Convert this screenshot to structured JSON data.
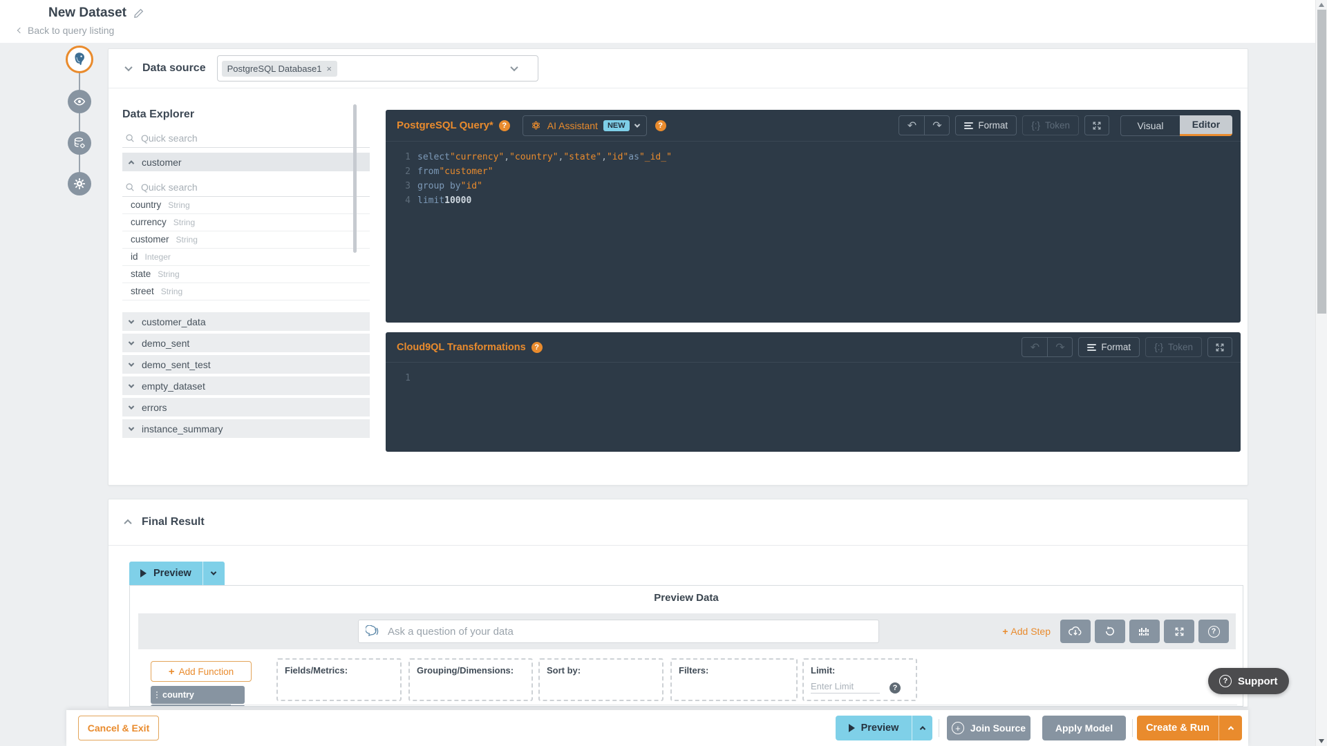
{
  "colors": {
    "accent_orange": "#e98b2d",
    "accent_blue": "#7fd0e8",
    "panel_dark": "#2d3a47",
    "button_gray": "#8794a1"
  },
  "icons": [
    "edit-pencil-icon",
    "back-chevron-icon",
    "postgresql-icon",
    "eye-icon",
    "database-gear-icon",
    "gear-icon",
    "search-icon",
    "chevron-icon",
    "help-icon",
    "openai-icon",
    "undo-icon",
    "redo-icon",
    "format-icon",
    "token-icon",
    "expand-icon",
    "play-icon",
    "ask-voice-icon",
    "download-icon",
    "refresh-icon",
    "chart-icon",
    "plus-icon",
    "drag-handle-icon",
    "question-icon"
  ],
  "header": {
    "title": "New Dataset",
    "back": "Back to query listing"
  },
  "datasource": {
    "label": "Data source",
    "selected_tag": "PostgreSQL Database1",
    "remove": "×"
  },
  "explorer": {
    "title": "Data Explorer",
    "search_placeholder": "Quick search",
    "inner_search_placeholder": "Quick search",
    "expanded_table": "customer",
    "fields": [
      {
        "name": "country",
        "type": "String"
      },
      {
        "name": "currency",
        "type": "String"
      },
      {
        "name": "customer",
        "type": "String"
      },
      {
        "name": "id",
        "type": "Integer"
      },
      {
        "name": "state",
        "type": "String"
      },
      {
        "name": "street",
        "type": "String"
      }
    ],
    "tables": [
      "customer_data",
      "demo_sent",
      "demo_sent_test",
      "empty_dataset",
      "errors",
      "instance_summary"
    ]
  },
  "sql_editor": {
    "title": "PostgreSQL Query*",
    "ai_assistant": "AI Assistant",
    "new_badge": "NEW",
    "undo": "↶",
    "redo": "↷",
    "format": "Format",
    "token": "Token",
    "token_glyph": "{:}",
    "visual": "Visual",
    "editor": "Editor",
    "code_lines": [
      {
        "n": "1",
        "tokens": [
          {
            "c": "kw",
            "t": "select "
          },
          {
            "c": "str",
            "t": "\"currency\""
          },
          {
            "c": "pln",
            "t": ", "
          },
          {
            "c": "str",
            "t": "\"country\""
          },
          {
            "c": "pln",
            "t": ", "
          },
          {
            "c": "str",
            "t": "\"state\""
          },
          {
            "c": "pln",
            "t": ", "
          },
          {
            "c": "str",
            "t": "\"id\""
          },
          {
            "c": "kw",
            "t": " as "
          },
          {
            "c": "str",
            "t": "\"_id_\""
          }
        ]
      },
      {
        "n": "2",
        "tokens": [
          {
            "c": "kw",
            "t": "from "
          },
          {
            "c": "str",
            "t": "\"customer\""
          }
        ]
      },
      {
        "n": "3",
        "tokens": [
          {
            "c": "kw",
            "t": "group by "
          },
          {
            "c": "str",
            "t": "\"id\""
          }
        ]
      },
      {
        "n": "4",
        "tokens": [
          {
            "c": "kw",
            "t": "limit "
          },
          {
            "c": "num",
            "t": "10000"
          }
        ]
      }
    ]
  },
  "transformations": {
    "title": "Cloud9QL Transformations",
    "undo": "↶",
    "redo": "↷",
    "format": "Format",
    "token": "Token",
    "token_glyph": "{:}",
    "line_number": "1"
  },
  "final_result": {
    "title": "Final Result",
    "preview_button": "Preview",
    "panel_title": "Preview Data",
    "ask_placeholder": "Ask a question of your data",
    "add_step": "Add Step",
    "add_function": "Add Function",
    "field_chips": [
      "country"
    ],
    "drop_zones": [
      "Fields/Metrics:",
      "Grouping/Dimensions:",
      "Sort by:",
      "Filters:"
    ],
    "limit_label": "Limit:",
    "limit_placeholder": "Enter Limit"
  },
  "footer": {
    "cancel": "Cancel & Exit",
    "preview": "Preview",
    "join_source": "Join Source",
    "apply_model": "Apply Model",
    "create_run": "Create & Run"
  },
  "support": {
    "label": "Support"
  }
}
